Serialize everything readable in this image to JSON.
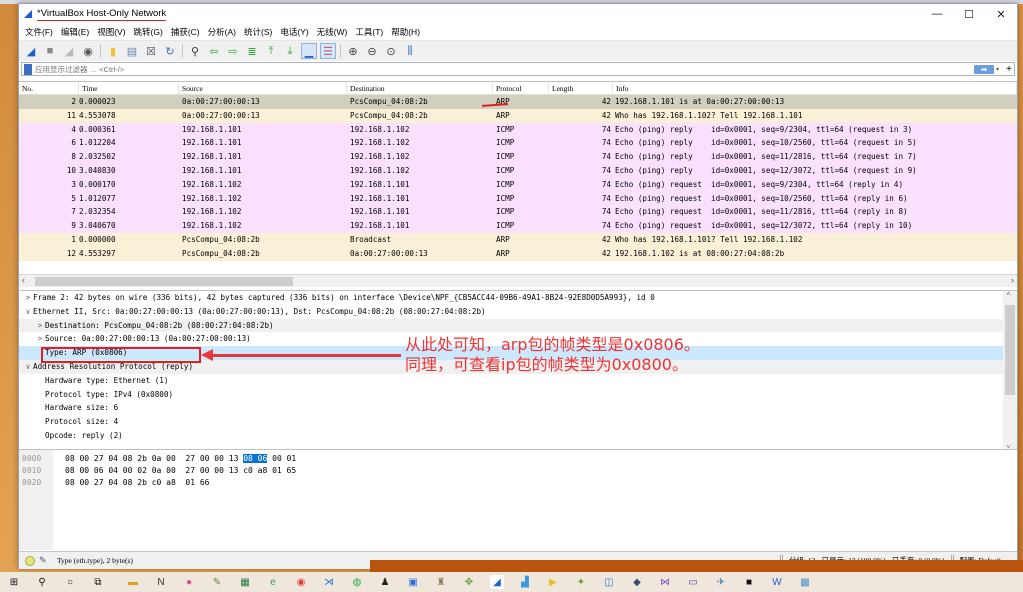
{
  "window": {
    "title": "*VirtualBox Host-Only Network",
    "controls": {
      "minimize": "—",
      "maximize": "☐",
      "close": "✕"
    }
  },
  "menu": [
    "文件(F)",
    "编辑(E)",
    "视图(V)",
    "跳转(G)",
    "捕获(C)",
    "分析(A)",
    "统计(S)",
    "电话(Y)",
    "无线(W)",
    "工具(T)",
    "帮助(H)"
  ],
  "toolbar": {
    "buttons": [
      {
        "name": "start-capture-icon",
        "glyph": "◢",
        "color": "#1a5fd0"
      },
      {
        "name": "stop-capture-icon",
        "glyph": "■",
        "color": "#888888"
      },
      {
        "name": "restart-capture-icon",
        "glyph": "◢",
        "color": "#b8b8b8"
      },
      {
        "name": "capture-options-icon",
        "glyph": "◉",
        "color": "#555555"
      },
      {
        "name": "open-file-icon",
        "glyph": "▮",
        "color": "#f0c030"
      },
      {
        "name": "save-file-icon",
        "glyph": "▤",
        "color": "#6a86b0"
      },
      {
        "name": "close-file-icon",
        "glyph": "☒",
        "color": "#445566"
      },
      {
        "name": "reload-file-icon",
        "glyph": "↻",
        "color": "#3b6fc4"
      },
      {
        "name": "find-packet-icon",
        "glyph": "⚲",
        "color": "#333333"
      },
      {
        "name": "go-back-icon",
        "glyph": "⇦",
        "color": "#2fae2f"
      },
      {
        "name": "go-forward-icon",
        "glyph": "⇨",
        "color": "#2fae2f"
      },
      {
        "name": "go-to-packet-icon",
        "glyph": "≣",
        "color": "#2fae2f"
      },
      {
        "name": "go-first-icon",
        "glyph": "⤒",
        "color": "#2fae2f"
      },
      {
        "name": "go-last-icon",
        "glyph": "⤓",
        "color": "#2fae2f"
      },
      {
        "name": "autoscroll-icon",
        "glyph": "▁",
        "color": "#1a5fd0"
      },
      {
        "name": "colorize-icon",
        "glyph": "☰",
        "color": "#c06070"
      },
      {
        "name": "zoom-in-icon",
        "glyph": "⊕",
        "color": "#444444"
      },
      {
        "name": "zoom-out-icon",
        "glyph": "⊖",
        "color": "#444444"
      },
      {
        "name": "zoom-normal-icon",
        "glyph": "⊙",
        "color": "#444444"
      },
      {
        "name": "resize-columns-icon",
        "glyph": "⫼",
        "color": "#3b6fc4"
      }
    ]
  },
  "filter": {
    "placeholder": "应用显示过滤器 … <Ctrl-/>",
    "apply": "➡",
    "dropdown": "▾",
    "add": "+"
  },
  "packet_list": {
    "columns": [
      "No.",
      "Time",
      "Source",
      "Destination",
      "Protocol",
      "Length",
      "Info"
    ],
    "rows": [
      {
        "no": "2",
        "time": "0.000023",
        "src": "0a:00:27:00:00:13",
        "dst": "PcsCompu_04:08:2b",
        "proto": "ARP",
        "len": "42",
        "info": "192.168.1.101 is at 0a:00:27:00:00:13",
        "kind": "sel"
      },
      {
        "no": "11",
        "time": "4.553078",
        "src": "0a:00:27:00:00:13",
        "dst": "PcsCompu_04:08:2b",
        "proto": "ARP",
        "len": "42",
        "info": "Who has 192.168.1.102? Tell 192.168.1.101",
        "kind": "arp"
      },
      {
        "no": "4",
        "time": "0.000361",
        "src": "192.168.1.101",
        "dst": "192.168.1.102",
        "proto": "ICMP",
        "len": "74",
        "info": "Echo (ping) reply    id=0x0001, seq=9/2304, ttl=64 (request in 3)",
        "kind": "icmp"
      },
      {
        "no": "6",
        "time": "1.012204",
        "src": "192.168.1.101",
        "dst": "192.168.1.102",
        "proto": "ICMP",
        "len": "74",
        "info": "Echo (ping) reply    id=0x0001, seq=10/2560, ttl=64 (request in 5)",
        "kind": "icmp"
      },
      {
        "no": "8",
        "time": "2.032502",
        "src": "192.168.1.101",
        "dst": "192.168.1.102",
        "proto": "ICMP",
        "len": "74",
        "info": "Echo (ping) reply    id=0x0001, seq=11/2816, ttl=64 (request in 7)",
        "kind": "icmp"
      },
      {
        "no": "10",
        "time": "3.040830",
        "src": "192.168.1.101",
        "dst": "192.168.1.102",
        "proto": "ICMP",
        "len": "74",
        "info": "Echo (ping) reply    id=0x0001, seq=12/3072, ttl=64 (request in 9)",
        "kind": "icmp"
      },
      {
        "no": "3",
        "time": "0.000170",
        "src": "192.168.1.102",
        "dst": "192.168.1.101",
        "proto": "ICMP",
        "len": "74",
        "info": "Echo (ping) request  id=0x0001, seq=9/2304, ttl=64 (reply in 4)",
        "kind": "icmp"
      },
      {
        "no": "5",
        "time": "1.012077",
        "src": "192.168.1.102",
        "dst": "192.168.1.101",
        "proto": "ICMP",
        "len": "74",
        "info": "Echo (ping) request  id=0x0001, seq=10/2560, ttl=64 (reply in 6)",
        "kind": "icmp"
      },
      {
        "no": "7",
        "time": "2.032354",
        "src": "192.168.1.102",
        "dst": "192.168.1.101",
        "proto": "ICMP",
        "len": "74",
        "info": "Echo (ping) request  id=0x0001, seq=11/2816, ttl=64 (reply in 8)",
        "kind": "icmp"
      },
      {
        "no": "9",
        "time": "3.040670",
        "src": "192.168.1.102",
        "dst": "192.168.1.101",
        "proto": "ICMP",
        "len": "74",
        "info": "Echo (ping) request  id=0x0001, seq=12/3072, ttl=64 (reply in 10)",
        "kind": "icmp"
      },
      {
        "no": "1",
        "time": "0.000000",
        "src": "PcsCompu_04:08:2b",
        "dst": "Broadcast",
        "proto": "ARP",
        "len": "42",
        "info": "Who has 192.168.1.101? Tell 192.168.1.102",
        "kind": "arp"
      },
      {
        "no": "12",
        "time": "4.553297",
        "src": "PcsCompu_04:08:2b",
        "dst": "0a:00:27:00:00:13",
        "proto": "ARP",
        "len": "42",
        "info": "192.168.1.102 is at 08:00:27:04:08:2b",
        "kind": "arp"
      }
    ],
    "row_colors": {
      "arp": "#faf0d7",
      "icmp": "#fce0ff",
      "sel": "#d3cfbf"
    }
  },
  "details": {
    "rows": [
      {
        "arrow": ">",
        "indent": 0,
        "text": "Frame 2: 42 bytes on wire (336 bits), 42 bytes captured (336 bits) on interface \\Device\\NPF_{CB5ACC44-09B6-49A1-8B24-92E8D0D5A993}, id 0",
        "style": ""
      },
      {
        "arrow": "∨",
        "indent": 0,
        "text": "Ethernet II, Src: 0a:00:27:00:00:13 (0a:00:27:00:00:13), Dst: PcsCompu_04:08:2b (08:00:27:04:08:2b)",
        "style": ""
      },
      {
        "arrow": ">",
        "indent": 1,
        "text": "Destination: PcsCompu_04:08:2b (08:00:27:04:08:2b)",
        "style": "alt"
      },
      {
        "arrow": ">",
        "indent": 1,
        "text": "Source: 0a:00:27:00:00:13 (0a:00:27:00:00:13)",
        "style": ""
      },
      {
        "arrow": "",
        "indent": 1,
        "text": "Type: ARP (0x0806)",
        "style": "sel"
      },
      {
        "arrow": "∨",
        "indent": 0,
        "text": "Address Resolution Protocol (reply)",
        "style": "alt"
      },
      {
        "arrow": "",
        "indent": 1,
        "text": "Hardware type: Ethernet (1)",
        "style": ""
      },
      {
        "arrow": "",
        "indent": 1,
        "text": "Protocol type: IPv4 (0x0800)",
        "style": ""
      },
      {
        "arrow": "",
        "indent": 1,
        "text": "Hardware size: 6",
        "style": ""
      },
      {
        "arrow": "",
        "indent": 1,
        "text": "Protocol size: 4",
        "style": ""
      },
      {
        "arrow": "",
        "indent": 1,
        "text": "Opcode: reply (2)",
        "style": ""
      }
    ],
    "annotation": {
      "line1": "从此处可知，arp包的帧类型是0x0806。",
      "line2": "同理，可查看ip包的帧类型为0x0800。",
      "color": "#ee3333"
    }
  },
  "bytes": {
    "rows": [
      {
        "offset": "0000",
        "pre": "08 00 27 04 08 2b 0a 00  27 00 00 13 ",
        "hl": "08 06",
        "post": " 00 01"
      },
      {
        "offset": "0010",
        "pre": "08 00 06 04 00 02 0a 00  27 00 00 13 c0 a8 01 65",
        "hl": "",
        "post": ""
      },
      {
        "offset": "0020",
        "pre": "08 00 27 04 08 2b c0 a8  01 66",
        "hl": "",
        "post": ""
      }
    ]
  },
  "status": {
    "field": "Type (eth.type), 2 byte(s)",
    "packets": "分组: 12 · 已显示: 12 (100.0%) · 已丢弃: 0 (0.0%)",
    "profile": "配置: Default"
  },
  "taskbar": {
    "items": [
      {
        "name": "start-icon",
        "glyph": "⊞",
        "color": "#111111"
      },
      {
        "name": "search-icon",
        "glyph": "⚲",
        "color": "#111111"
      },
      {
        "name": "cortana-icon",
        "glyph": "○",
        "color": "#111111"
      },
      {
        "name": "task-view-icon",
        "glyph": "⧉",
        "color": "#111111"
      },
      {
        "name": "file-explorer-icon",
        "glyph": "▬",
        "color": "#e0a020"
      },
      {
        "name": "notion-icon",
        "glyph": "N",
        "color": "#333333"
      },
      {
        "name": "paint-icon",
        "glyph": "●",
        "color": "#e04a9a"
      },
      {
        "name": "notepad-icon",
        "glyph": "✎",
        "color": "#5a8a3a"
      },
      {
        "name": "excel-icon",
        "glyph": "▦",
        "color": "#1d7a3d"
      },
      {
        "name": "ie-icon",
        "glyph": "e",
        "color": "#35a050"
      },
      {
        "name": "chrome-icon",
        "glyph": "◉",
        "color": "#e04030"
      },
      {
        "name": "vscode-icon",
        "glyph": "⋊",
        "color": "#1a78d0"
      },
      {
        "name": "wechat-icon",
        "glyph": "◍",
        "color": "#2aae4a"
      },
      {
        "name": "qq-icon",
        "glyph": "♟",
        "color": "#222222"
      },
      {
        "name": "vbox-icon",
        "glyph": "▣",
        "color": "#2a6ad8"
      },
      {
        "name": "tool-icon",
        "glyph": "♜",
        "color": "#8a7a60"
      },
      {
        "name": "app-icon",
        "glyph": "✥",
        "color": "#6aa040"
      },
      {
        "name": "wireshark-icon",
        "glyph": "◢",
        "color": "#1a5fd0"
      },
      {
        "name": "app2-icon",
        "glyph": "▟",
        "color": "#3a9ae0"
      },
      {
        "name": "player-icon",
        "glyph": "▶",
        "color": "#e8c020"
      },
      {
        "name": "app3-icon",
        "glyph": "✦",
        "color": "#6aa040"
      },
      {
        "name": "app4-icon",
        "glyph": "◫",
        "color": "#2a7ad0"
      },
      {
        "name": "app5-icon",
        "glyph": "◆",
        "color": "#3a4a70"
      },
      {
        "name": "visual-studio-icon",
        "glyph": "⋈",
        "color": "#7a4ad0"
      },
      {
        "name": "terminal-icon",
        "glyph": "▭",
        "color": "#4a4aa0"
      },
      {
        "name": "app6-icon",
        "glyph": "✈",
        "color": "#3a80b0"
      },
      {
        "name": "cmd-icon",
        "glyph": "■",
        "color": "#111111"
      },
      {
        "name": "word-icon",
        "glyph": "W",
        "color": "#2a5ad0"
      },
      {
        "name": "app7-icon",
        "glyph": "▩",
        "color": "#4a90d0"
      }
    ]
  }
}
